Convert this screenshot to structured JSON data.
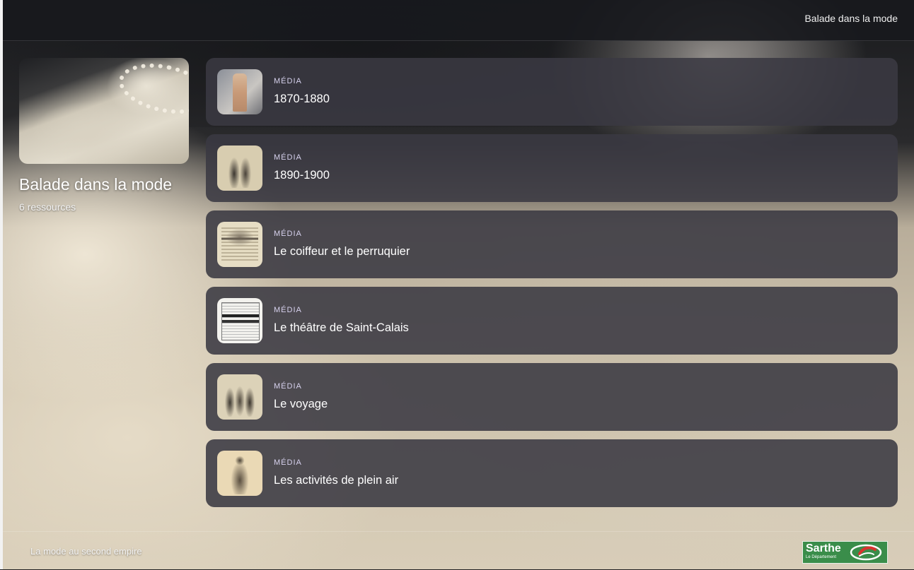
{
  "topbar": {
    "title": "Balade dans la mode"
  },
  "collection": {
    "title": "Balade dans la mode",
    "count": "6 ressources"
  },
  "items": [
    {
      "type": "MÉDIA",
      "title": "1870-1880"
    },
    {
      "type": "MÉDIA",
      "title": "1890-1900"
    },
    {
      "type": "MÉDIA",
      "title": "Le coiffeur et le perruquier"
    },
    {
      "type": "MÉDIA",
      "title": "Le théâtre de Saint-Calais"
    },
    {
      "type": "MÉDIA",
      "title": "Le voyage"
    },
    {
      "type": "MÉDIA",
      "title": "Les activités de plein air"
    }
  ],
  "footer": {
    "text": "La mode au second empire",
    "logo_text": "Sarthe",
    "logo_subtext": "Le Département"
  }
}
